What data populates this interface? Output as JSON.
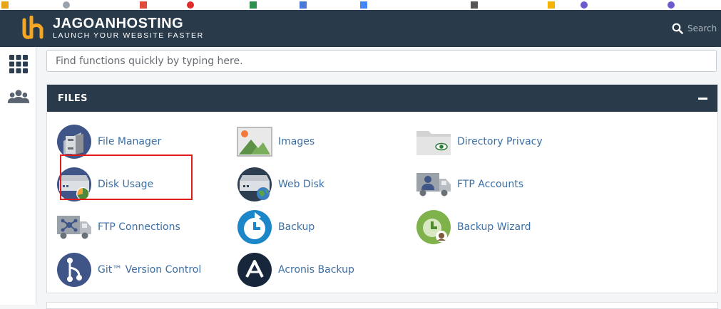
{
  "header": {
    "brand": "JAGOANHOSTING",
    "tagline": "LAUNCH YOUR WEBSITE FASTER",
    "search_placeholder": "Search"
  },
  "function_search": {
    "placeholder": "Find functions quickly by typing here."
  },
  "files_section": {
    "title": "FILES",
    "items": [
      {
        "label": "File Manager",
        "icon": "file-manager-icon"
      },
      {
        "label": "Images",
        "icon": "images-icon"
      },
      {
        "label": "Directory Privacy",
        "icon": "directory-privacy-icon"
      },
      {
        "label": "Disk Usage",
        "icon": "disk-usage-icon"
      },
      {
        "label": "Web Disk",
        "icon": "web-disk-icon"
      },
      {
        "label": "FTP Accounts",
        "icon": "ftp-accounts-icon"
      },
      {
        "label": "FTP Connections",
        "icon": "ftp-connections-icon"
      },
      {
        "label": "Backup",
        "icon": "backup-icon"
      },
      {
        "label": "Backup Wizard",
        "icon": "backup-wizard-icon"
      },
      {
        "label": "Git™ Version Control",
        "icon": "git-icon"
      },
      {
        "label": "Acronis Backup",
        "icon": "acronis-icon"
      }
    ]
  },
  "colors": {
    "header_bg": "#293a4a",
    "link": "#3a6ea5",
    "brand_accent": "#f5a623",
    "highlight": "#e21b1b"
  }
}
